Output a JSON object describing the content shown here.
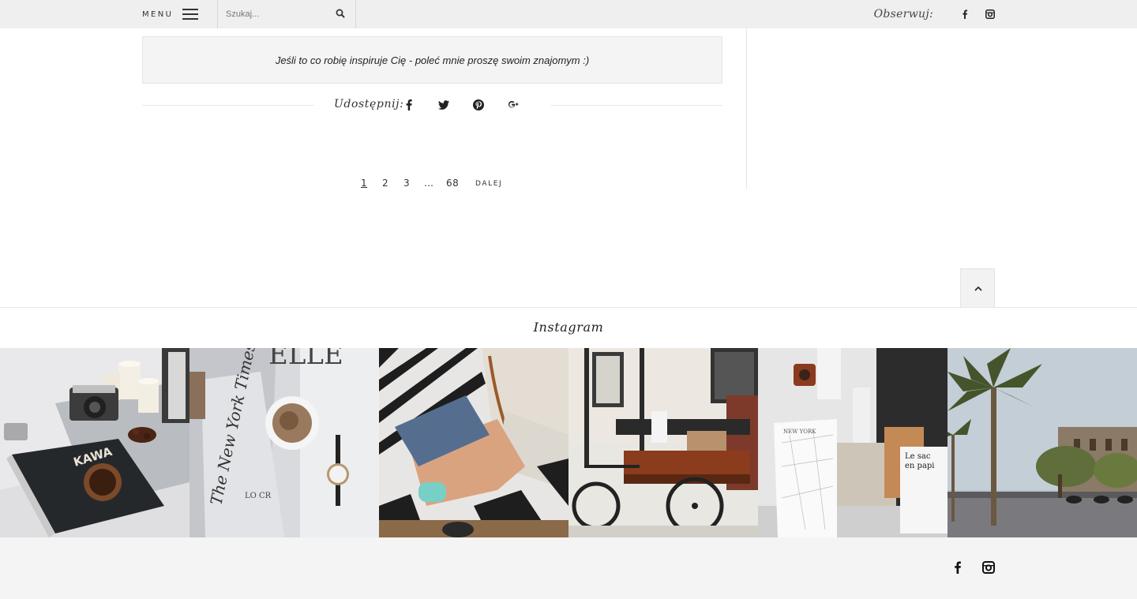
{
  "topbar": {
    "menu_label": "MENU",
    "search": {
      "placeholder": "Szukaj..."
    },
    "follow_label": "Obserwuj:",
    "social_icons": [
      "facebook-icon",
      "instagram-icon"
    ]
  },
  "post": {
    "recommend_text": "Jeśli to co robię inspiruje Cię - poleć mnie proszę swoim znajomym :)",
    "share_label": "Udostępnij:",
    "share_icons": [
      "facebook-icon",
      "twitter-icon",
      "pinterest-icon",
      "google-plus-icon"
    ]
  },
  "pagination": {
    "pages": [
      "1",
      "2",
      "3",
      "…",
      "68"
    ],
    "current": "1",
    "next_label": "DALEJ"
  },
  "back_to_top": {
    "icon": "chevron-up-icon"
  },
  "instagram": {
    "title": "Instagram",
    "photos": [
      "coffee book KAWA with camera and candles",
      "newspaper with coffee cup and watch",
      "striped top and denim shorts on patterned towel",
      "coffee cart bicycle in street",
      "New York map and stationery",
      "palm trees and plaza"
    ]
  },
  "footer": {
    "social_icons": [
      "facebook-icon",
      "instagram-icon"
    ]
  },
  "colors": {
    "topbar_bg": "#efefef",
    "footer_bg": "#f4f4f4",
    "text": "#222222"
  }
}
